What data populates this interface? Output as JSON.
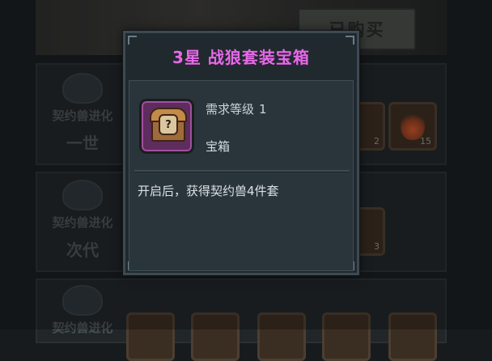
{
  "background": {
    "bought_button_label": "已购买",
    "rows": [
      {
        "title": "契约兽进化",
        "subtitle": "一世",
        "item_counts": [
          "2",
          "15"
        ]
      },
      {
        "title": "契约兽进化",
        "subtitle": "次代",
        "item_counts": [
          "3"
        ]
      },
      {
        "title": "契约兽进化",
        "subtitle": ""
      }
    ]
  },
  "modal": {
    "title": "3星 战狼套装宝箱",
    "title_color": "#e46be8",
    "item_icon": "treasure-chest-icon",
    "requirement_label": "需求等级",
    "requirement_value": "1",
    "item_type": "宝箱",
    "description": "开启后，获得契约兽4件套"
  }
}
